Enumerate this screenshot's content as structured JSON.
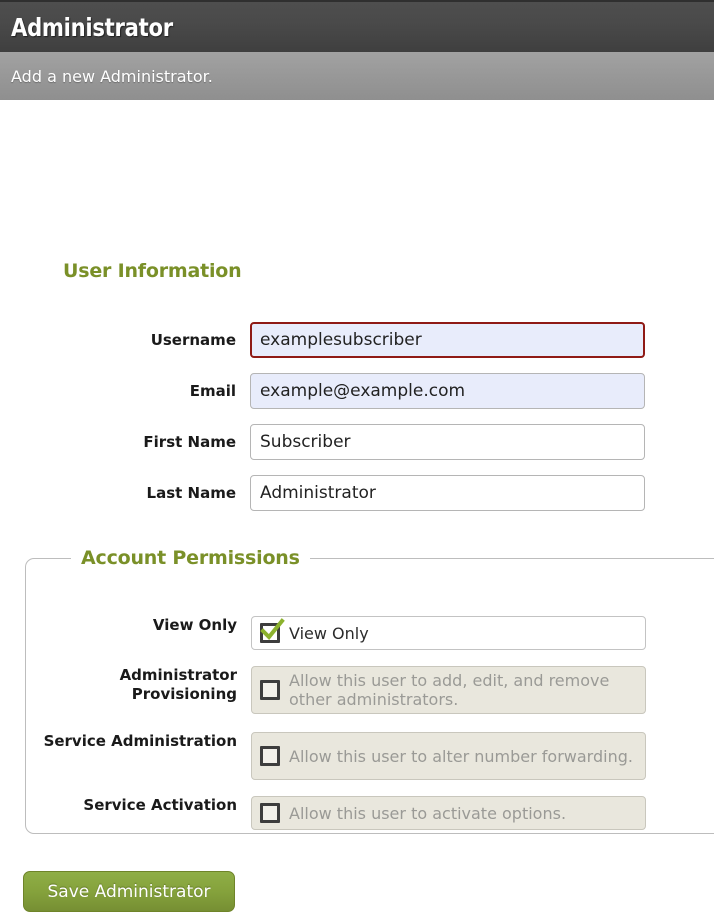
{
  "header": {
    "title": "Administrator",
    "subtitle": "Add a new Administrator."
  },
  "user_information": {
    "section_title": "User Information",
    "fields": [
      {
        "label": "Username",
        "value": "examplesubscriber",
        "state": "error"
      },
      {
        "label": "Email",
        "value": "example@example.com",
        "state": "highlight"
      },
      {
        "label": "First Name",
        "value": "Subscriber",
        "state": "normal"
      },
      {
        "label": "Last Name",
        "value": "Administrator",
        "state": "normal"
      }
    ]
  },
  "account_permissions": {
    "legend": "Account Permissions",
    "rows": [
      {
        "label": "View Only",
        "text": "View Only",
        "checked": true,
        "disabled": false
      },
      {
        "label": "Administrator Provisioning",
        "label_line1": "Administrator",
        "label_line2": "Provisioning",
        "text": "Allow this user to add, edit, and remove other administrators.",
        "checked": false,
        "disabled": true
      },
      {
        "label": "Service Administration",
        "text": "Allow this user to alter number forwarding.",
        "checked": false,
        "disabled": true
      },
      {
        "label": "Service Activation",
        "text": "Allow this user to activate options.",
        "checked": false,
        "disabled": true
      }
    ]
  },
  "actions": {
    "save_label": "Save Administrator"
  },
  "colors": {
    "accent_green": "#7a9028",
    "button_green": "#85a23c",
    "error_border": "#8f1a15",
    "highlight_bg": "#e8ecfb",
    "disabled_bg": "#e9e7dd"
  }
}
